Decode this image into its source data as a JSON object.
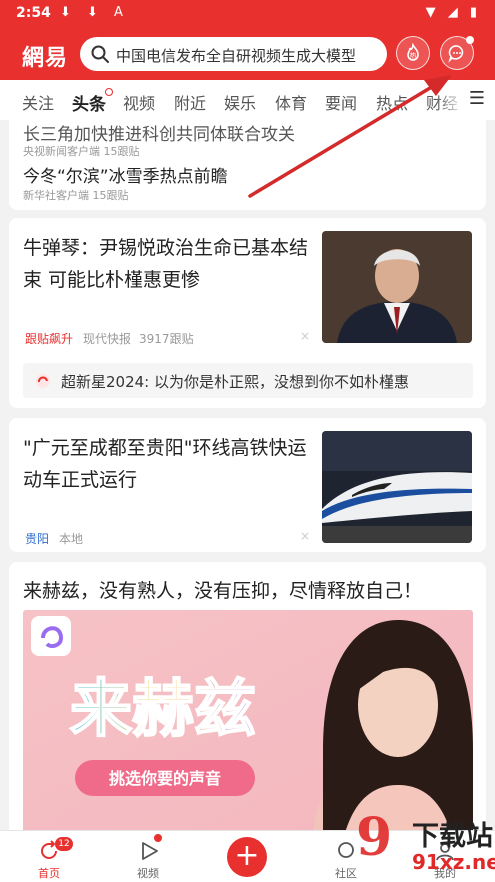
{
  "status_bar": {
    "time": "2:54",
    "left_icons": "⬇ ⬇ A",
    "right_icons": "▼ ◢ ▮"
  },
  "header": {
    "logo": "網易",
    "search_placeholder": "中国电信发布全自研视频生成大模型",
    "hot_label": "热"
  },
  "tabs": [
    {
      "label": "关注"
    },
    {
      "label": "头条"
    },
    {
      "label": "视频"
    },
    {
      "label": "附近"
    },
    {
      "label": "娱乐"
    },
    {
      "label": "体育"
    },
    {
      "label": "要闻"
    },
    {
      "label": "热点"
    },
    {
      "label": "财经"
    }
  ],
  "card_top": {
    "item1_title": "长三角加快推进科创共同体联合攻关",
    "item1_meta": "央视新闻客户端  15跟贴",
    "item2_title": "今冬“尔滨”冰雪季热点前瞻",
    "item2_meta": "新华社客户端  15跟贴"
  },
  "news1": {
    "title": "牛弹琴：尹锡悦政治生命已基本结束 可能比朴槿惠更惨",
    "tag": "跟贴飙升",
    "source": "现代快报",
    "comments": "3917跟贴",
    "close": "×",
    "related": "超新星2024: 以为你是朴正熙，没想到你不如朴槿惠"
  },
  "news2": {
    "title": "\"广元至成都至贵阳\"环线高铁快运动车正式运行",
    "location": "贵阳",
    "source": "本地",
    "close": "×"
  },
  "ad": {
    "title": "来赫兹，没有熟人，没有压抑，尽情释放自己！",
    "brand_text": "来赫兹",
    "banner_text": "挑选你要的声音"
  },
  "bottom_nav": {
    "home": "首页",
    "home_badge": "12",
    "video": "视频",
    "social": "社区",
    "mine": "我的"
  },
  "watermark": {
    "big": "9",
    "line1": "下载站",
    "line2": "91xz.net"
  },
  "colors": {
    "brand_red": "#e8302f"
  }
}
